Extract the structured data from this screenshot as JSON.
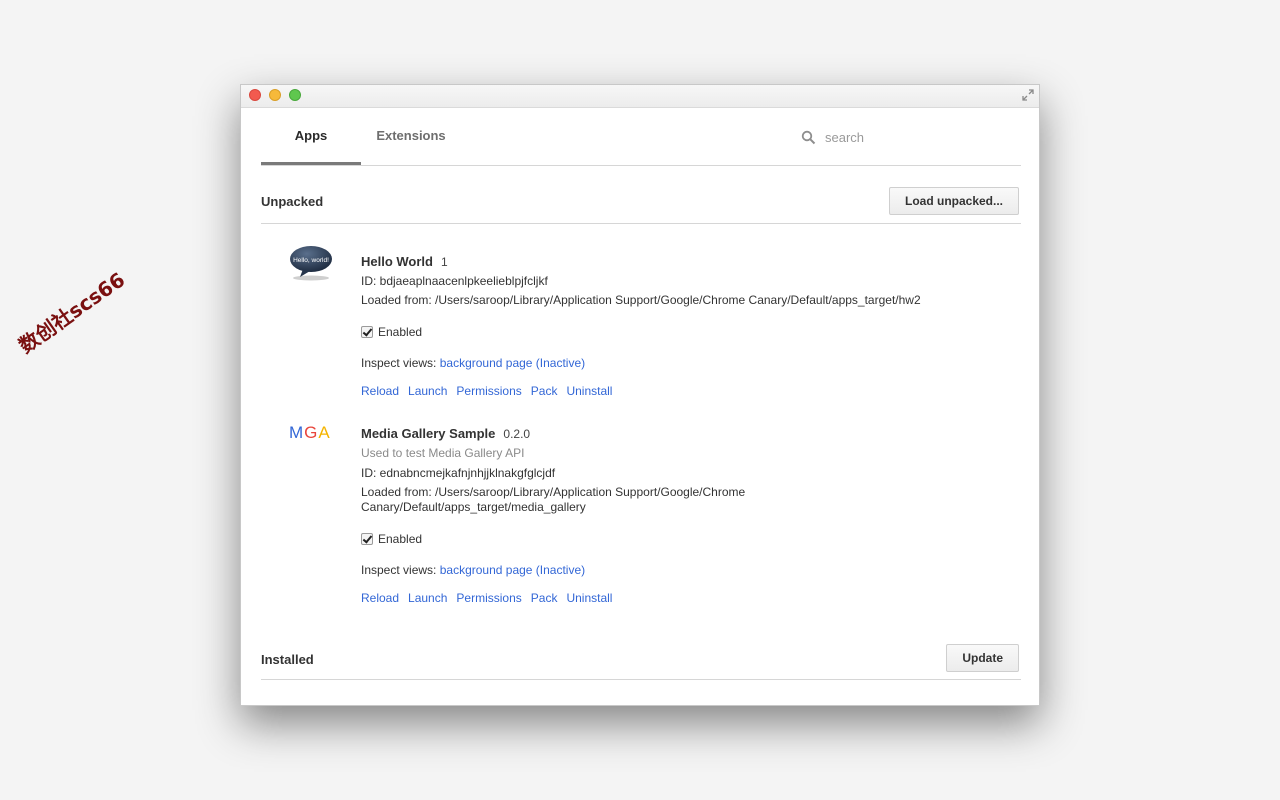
{
  "watermark": "数创社scs66",
  "colors": {
    "link": "#3367d6",
    "accent_tab": "#7a7a7a",
    "mga_m": "#3367d6",
    "mga_g": "#e8453c",
    "mga_a": "#f4b400"
  },
  "tabs": [
    {
      "label": "Apps",
      "selected": true
    },
    {
      "label": "Extensions",
      "selected": false
    }
  ],
  "search": {
    "placeholder": "search",
    "value": ""
  },
  "sections": {
    "unpacked": {
      "title": "Unpacked",
      "button": "Load unpacked..."
    },
    "installed": {
      "title": "Installed",
      "button": "Update"
    }
  },
  "apps": [
    {
      "icon": "hello-world-speech-bubble",
      "icon_text": "Hello, world!",
      "name": "Hello World",
      "version": "1",
      "description": "",
      "id_line": "ID: bdjaeaplnaacenlpkeelieblpjfcljkf",
      "loaded_line1": "Loaded from: /Users/saroop/Library/Application Support/Google/Chrome Canary/Default/apps_target/hw2",
      "loaded_line2": "",
      "enabled_label": "Enabled",
      "enabled": true,
      "inspect_label": "Inspect views:",
      "inspect_link": "background page (Inactive)",
      "actions": [
        "Reload",
        "Launch",
        "Permissions",
        "Pack",
        "Uninstall"
      ]
    },
    {
      "icon": "mga-logo",
      "icon_letters": [
        "M",
        "G",
        "A"
      ],
      "name": "Media Gallery Sample",
      "version": "0.2.0",
      "description": "Used to test Media Gallery API",
      "id_line": "ID: ednabncmejkafnjnhjjklnakgfglcjdf",
      "loaded_line1": "Loaded from: /Users/saroop/Library/Application Support/Google/Chrome",
      "loaded_line2": "Canary/Default/apps_target/media_gallery",
      "enabled_label": "Enabled",
      "enabled": true,
      "inspect_label": "Inspect views:",
      "inspect_link": "background page (Inactive)",
      "actions": [
        "Reload",
        "Launch",
        "Permissions",
        "Pack",
        "Uninstall"
      ]
    }
  ]
}
